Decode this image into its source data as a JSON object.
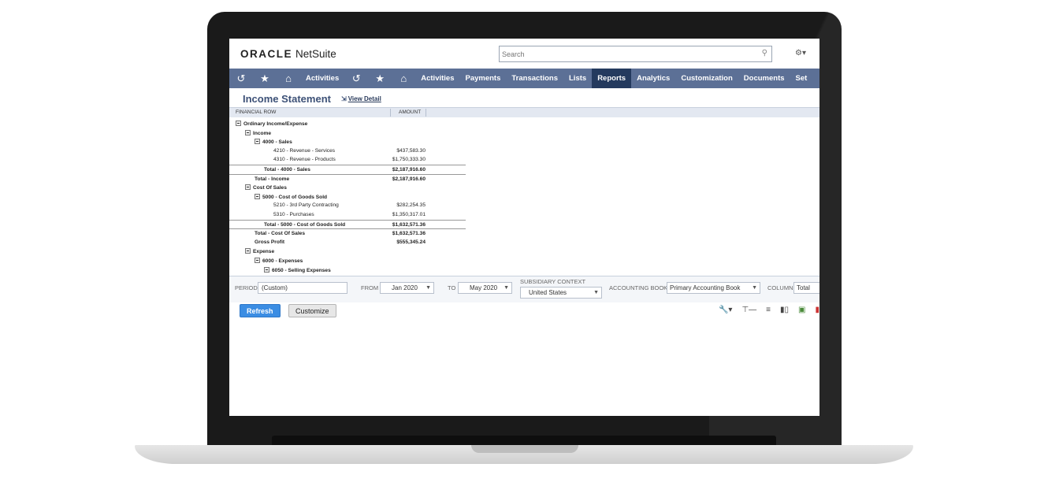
{
  "app": {
    "logo_oracle": "ORACLE",
    "logo_netsuite": "NetSuite"
  },
  "search": {
    "placeholder": "Search"
  },
  "nav": {
    "items": [
      "Activities",
      "Activities",
      "Payments",
      "Transactions",
      "Lists",
      "Reports",
      "Analytics",
      "Customization",
      "Documents",
      "Set"
    ],
    "active": "Reports"
  },
  "page": {
    "title": "Income Statement",
    "view_detail": "View Detail"
  },
  "table": {
    "headers": [
      "FINANCIAL ROW",
      "AMOUNT"
    ],
    "rows": [
      {
        "label": "Ordinary Income/Expense",
        "amount": "",
        "indent": 0,
        "toggle": true,
        "bold": true,
        "line": false
      },
      {
        "label": "Income",
        "amount": "",
        "indent": 1,
        "toggle": true,
        "bold": true,
        "line": false
      },
      {
        "label": "4000 - Sales",
        "amount": "",
        "indent": 2,
        "toggle": true,
        "bold": true,
        "line": false
      },
      {
        "label": "4210 - Revenue - Services",
        "amount": "$437,583.30",
        "indent": 4,
        "toggle": false,
        "bold": false,
        "line": false
      },
      {
        "label": "4310 - Revenue - Products",
        "amount": "$1,750,333.30",
        "indent": 4,
        "toggle": false,
        "bold": false,
        "line": false
      },
      {
        "label": "Total - 4000 - Sales",
        "amount": "$2,187,916.60",
        "indent": 3,
        "toggle": false,
        "bold": true,
        "line": true
      },
      {
        "label": "Total - Income",
        "amount": "$2,187,916.60",
        "indent": 2,
        "toggle": false,
        "bold": true,
        "line": true
      },
      {
        "label": "Cost Of Sales",
        "amount": "",
        "indent": 1,
        "toggle": true,
        "bold": true,
        "line": false
      },
      {
        "label": "5000 - Cost of Goods Sold",
        "amount": "",
        "indent": 2,
        "toggle": true,
        "bold": true,
        "line": false
      },
      {
        "label": "5210 - 3rd Party Contracting",
        "amount": "$282,254.35",
        "indent": 4,
        "toggle": false,
        "bold": false,
        "line": false
      },
      {
        "label": "5310 - Purchases",
        "amount": "$1,350,317.01",
        "indent": 4,
        "toggle": false,
        "bold": false,
        "line": false
      },
      {
        "label": "Total - 5000 - Cost of Goods Sold",
        "amount": "$1,632,571.36",
        "indent": 3,
        "toggle": false,
        "bold": true,
        "line": true
      },
      {
        "label": "Total - Cost Of Sales",
        "amount": "$1,632,571.36",
        "indent": 2,
        "toggle": false,
        "bold": true,
        "line": true
      },
      {
        "label": "Gross Profit",
        "amount": "$555,345.24",
        "indent": 2,
        "toggle": false,
        "bold": true,
        "line": false
      },
      {
        "label": "Expense",
        "amount": "",
        "indent": 1,
        "toggle": true,
        "bold": true,
        "line": false
      },
      {
        "label": "6000 - Expenses",
        "amount": "",
        "indent": 2,
        "toggle": true,
        "bold": true,
        "line": false
      },
      {
        "label": "6050 - Selling Expenses",
        "amount": "",
        "indent": 3,
        "toggle": true,
        "bold": true,
        "line": false
      }
    ]
  },
  "filters": {
    "period_label": "PERIOD",
    "period_value": "(Custom)",
    "from_label": "FROM",
    "from_value": "Jan 2020",
    "to_label": "TO",
    "to_value": "May 2020",
    "subsidiary_label": "SUBSIDIARY CONTEXT",
    "subsidiary_value": "United States",
    "book_label": "ACCOUNTING BOOK",
    "book_value": "Primary Accounting Book",
    "column_label": "COLUMN",
    "column_value": "Total"
  },
  "buttons": {
    "refresh": "Refresh",
    "customize": "Customize"
  },
  "colors": {
    "nav_bg": "#5c7096",
    "nav_active": "#243a5e",
    "primary_button": "#3b8de3",
    "title": "#3d5177"
  }
}
